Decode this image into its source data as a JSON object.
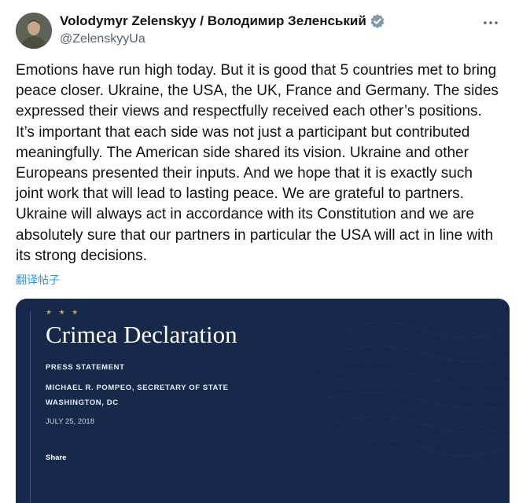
{
  "author": {
    "display_name": "Volodymyr Zelenskyy / Володимир Зеленський",
    "handle": "@ZelenskyyUa"
  },
  "tweet": {
    "text": "Emotions have run high today. But it is good that 5 countries met to bring\npeace closer. Ukraine, the USA, the UK, France and Germany. The sides\nexpressed their views and respectfully received each other’s positions.\nIt’s important that each side was not just a participant but contributed\nmeaningfully. The American side shared its vision. Ukraine and other\nEuropeans presented their inputs. And we hope that it is exactly such\njoint work that will lead to lasting peace. We are grateful to partners.\nUkraine will always act in accordance with its Constitution and we are\nabsolutely sure that our partners in particular the USA will act in line with\nits strong decisions.",
    "translate_label": "翻译帖子"
  },
  "card": {
    "stars": "★ ★ ★",
    "title": "Crimea Declaration",
    "statement_type": "PRESS STATEMENT",
    "author_line": "MICHAEL R. POMPEO, SECRETARY OF STATE",
    "location": "WASHINGTON, DC",
    "date": "JULY 25, 2018",
    "share_label": "Share"
  },
  "icons": {
    "verified": "verified-badge-icon",
    "more": "more-options-icon"
  },
  "colors": {
    "accent_blue": "#1d9bf0",
    "card_background": "#16294a",
    "verified_gray": "#829aab"
  }
}
